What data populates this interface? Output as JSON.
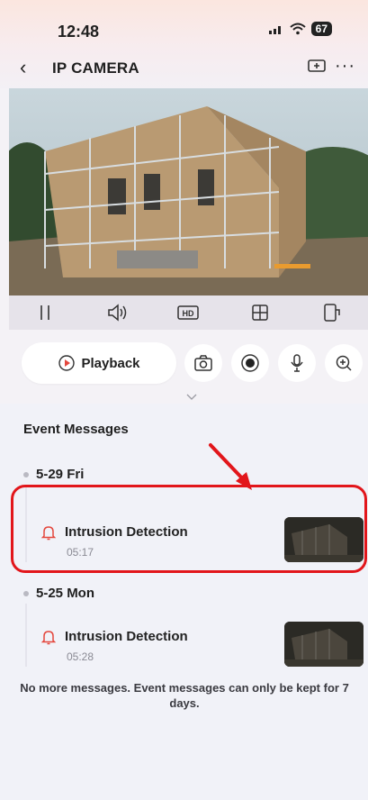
{
  "status": {
    "time": "12:48",
    "battery": "67"
  },
  "nav": {
    "title": "IP CAMERA"
  },
  "controls": [
    "pause-icon",
    "speaker-icon",
    "hd-icon",
    "layout-icon",
    "rotate-icon"
  ],
  "controls_hd_label": "HD",
  "actions": {
    "playback_label": "Playback"
  },
  "events": {
    "title": "Event Messages",
    "groups": [
      {
        "date": "5-29 Fri",
        "items": [
          {
            "title": "Intrusion Detection",
            "time": "05:17"
          }
        ]
      },
      {
        "date": "5-25 Mon",
        "items": [
          {
            "title": "Intrusion Detection",
            "time": "05:28"
          }
        ]
      }
    ],
    "footer": "No more messages. Event messages can only be kept for 7 days."
  },
  "colors": {
    "alert_red": "#e2161b",
    "bell": "#e4473d",
    "accent_record": "#222222"
  }
}
